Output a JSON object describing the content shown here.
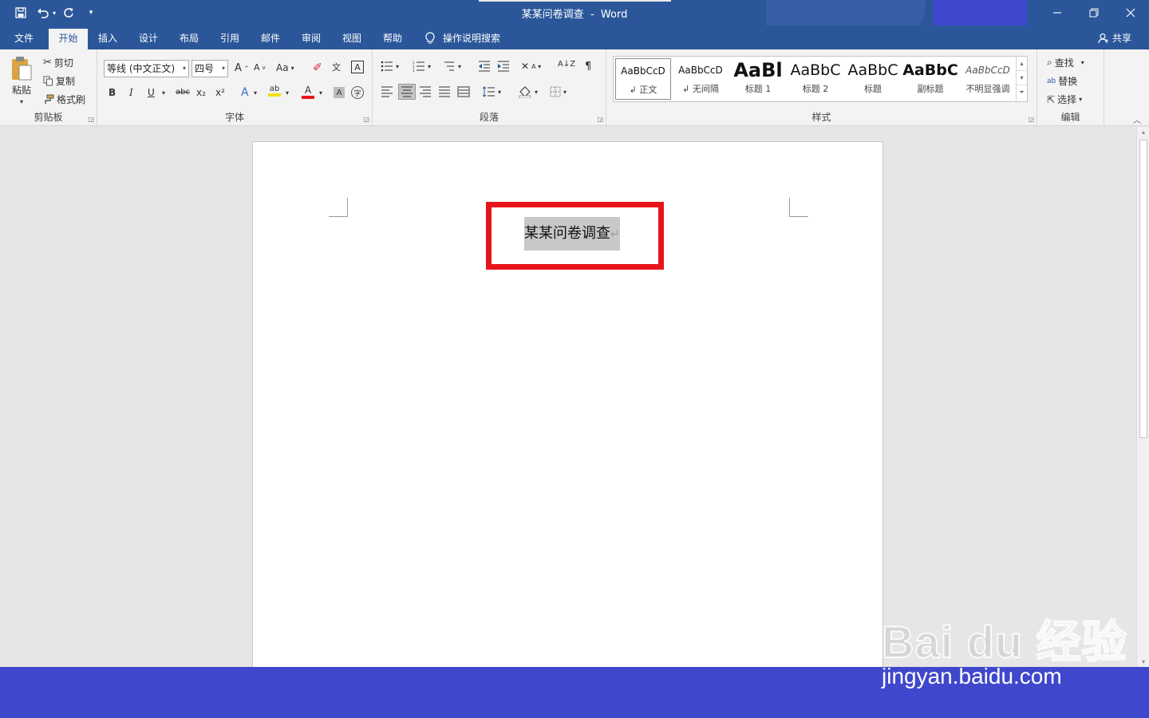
{
  "app": {
    "document_title": "某某问卷调查",
    "separator": "-",
    "app_name": "Word"
  },
  "qat": {
    "save_icon": "save-icon",
    "undo_icon": "undo-icon",
    "redo_icon": "redo-icon",
    "customize_icon": "customize-qat-icon"
  },
  "tabs": [
    {
      "label": "文件"
    },
    {
      "label": "开始"
    },
    {
      "label": "插入"
    },
    {
      "label": "设计"
    },
    {
      "label": "布局"
    },
    {
      "label": "引用"
    },
    {
      "label": "邮件"
    },
    {
      "label": "审阅"
    },
    {
      "label": "视图"
    },
    {
      "label": "帮助"
    }
  ],
  "active_tab": "开始",
  "tell_me": "操作说明搜索",
  "share": "共享",
  "clipboard": {
    "paste": "粘贴",
    "cut": "剪切",
    "copy": "复制",
    "format_painter": "格式刷",
    "label": "剪贴板"
  },
  "font": {
    "font_name": "等线 (中文正文)",
    "font_size": "四号",
    "change_case": "Aa",
    "bold": "B",
    "italic": "I",
    "underline": "U",
    "strikethrough": "abc",
    "subscript": "x₂",
    "superscript": "x²",
    "label": "字体"
  },
  "paragraph": {
    "label": "段落"
  },
  "styles": {
    "items": [
      {
        "sample": "AaBbCcD",
        "name": "正文"
      },
      {
        "sample": "AaBbCcD",
        "name": "无间隔"
      },
      {
        "sample": "AaBl",
        "name": "标题 1"
      },
      {
        "sample": "AaBbC",
        "name": "标题 2"
      },
      {
        "sample": "AaBbC",
        "name": "标题"
      },
      {
        "sample": "AaBbC",
        "name": "副标题"
      },
      {
        "sample": "AaBbCcD",
        "name": "不明显强调"
      }
    ],
    "label": "样式"
  },
  "editing": {
    "find": "查找",
    "replace": "替换",
    "select": "选择",
    "label": "编辑"
  },
  "document": {
    "selected_text": "某某问卷调查",
    "paragraph_mark": "↵"
  },
  "watermark": {
    "logo": "Bai du 经验",
    "url": "jingyan.baidu.com"
  },
  "colors": {
    "title_bar": "#2b579a",
    "highlight_box": "#e8141c",
    "status_bar": "#3f48cc"
  }
}
